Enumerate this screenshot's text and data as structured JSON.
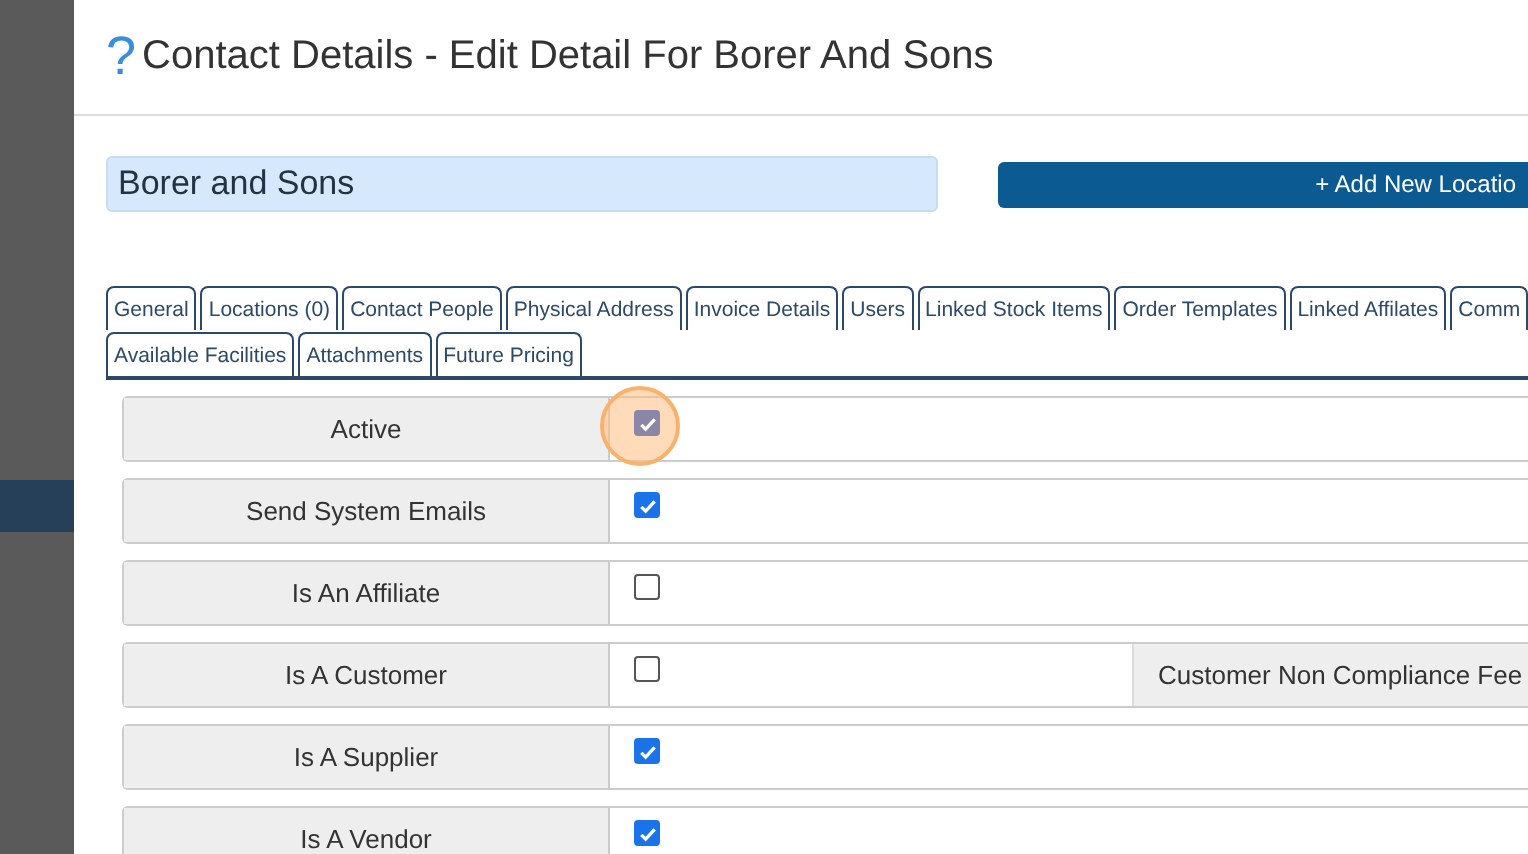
{
  "dialog": {
    "help_icon": "?",
    "title": "Contact Details - Edit Detail For Borer And Sons"
  },
  "name_field": {
    "value": "Borer and Sons"
  },
  "add_location_button": {
    "label": "+ Add New Locatio"
  },
  "tabs": [
    {
      "label": "General",
      "selected": false
    },
    {
      "label": "Locations (0)",
      "selected": false
    },
    {
      "label": "Contact People",
      "selected": false
    },
    {
      "label": "Physical Address",
      "selected": false
    },
    {
      "label": "Invoice Details",
      "selected": false
    },
    {
      "label": "Users",
      "selected": false
    },
    {
      "label": "Linked Stock Items",
      "selected": false
    },
    {
      "label": "Order Templates",
      "selected": false
    },
    {
      "label": "Linked Affilates",
      "selected": false
    },
    {
      "label": "Comm",
      "selected": false
    },
    {
      "label": "Available Facilities",
      "selected": false
    },
    {
      "label": "Attachments",
      "selected": false
    },
    {
      "label": "Future Pricing",
      "selected": false
    }
  ],
  "fields": [
    {
      "label": "Active",
      "checked": true,
      "disabled": true,
      "highlighted": true
    },
    {
      "label": "Send System Emails",
      "checked": true,
      "disabled": false,
      "highlighted": false
    },
    {
      "label": "Is An Affiliate",
      "checked": false,
      "disabled": false,
      "highlighted": false
    },
    {
      "label": "Is A Customer",
      "checked": false,
      "disabled": false,
      "highlighted": false,
      "extra_label": "Customer Non Compliance Fee"
    },
    {
      "label": "Is A Supplier",
      "checked": true,
      "disabled": false,
      "highlighted": false
    },
    {
      "label": "Is A Vendor",
      "checked": true,
      "disabled": false,
      "highlighted": false
    }
  ]
}
